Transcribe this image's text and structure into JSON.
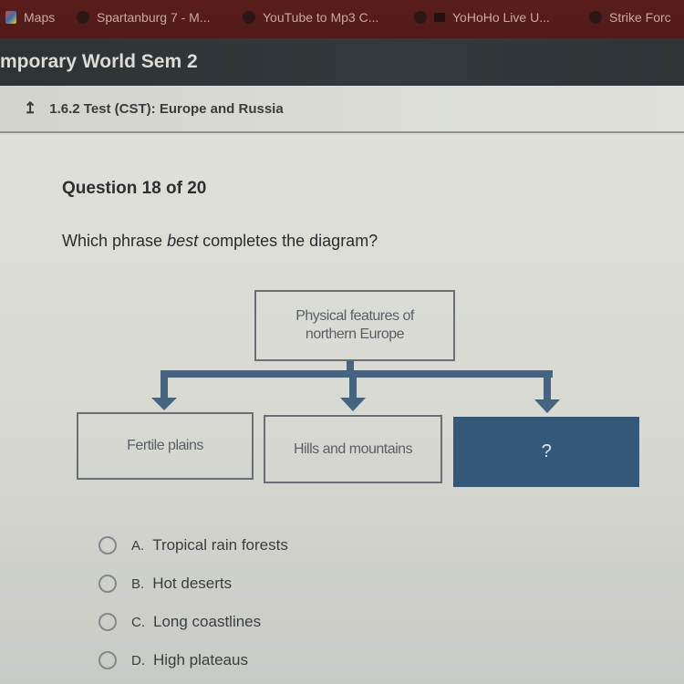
{
  "bookmarks": [
    {
      "icon": "google-maps-icon",
      "label": "Maps"
    },
    {
      "icon": "site-icon",
      "label": "Spartanburg 7 - M..."
    },
    {
      "icon": "site-icon",
      "label": "YouTube to Mp3 C..."
    },
    {
      "icon": "site-icon",
      "label": "YoHoHo Live U..."
    },
    {
      "icon": "site-icon",
      "label": "Strike Forc"
    }
  ],
  "course": {
    "title": "mporary World Sem 2"
  },
  "breadcrumb": {
    "icon": "up-arrow-icon",
    "glyph": "↥",
    "label": "1.6.2  Test (CST):  Europe and Russia"
  },
  "question": {
    "number_label": "Question 18 of 20",
    "prompt_before": "Which phrase ",
    "prompt_emphasis": "best",
    "prompt_after": " completes the diagram?"
  },
  "diagram": {
    "root": "Physical features of northern Europe",
    "children": [
      "Fertile plains",
      "Hills and mountains",
      "?"
    ],
    "colors": {
      "line": "#466480",
      "highlight_box": "#34587a",
      "box_border": "#6b6f72"
    }
  },
  "options": [
    {
      "letter": "A.",
      "text": "Tropical rain forests",
      "selected": false
    },
    {
      "letter": "B.",
      "text": "Hot deserts",
      "selected": false
    },
    {
      "letter": "C.",
      "text": "Long coastlines",
      "selected": false
    },
    {
      "letter": "D.",
      "text": "High plateaus",
      "selected": false
    }
  ]
}
